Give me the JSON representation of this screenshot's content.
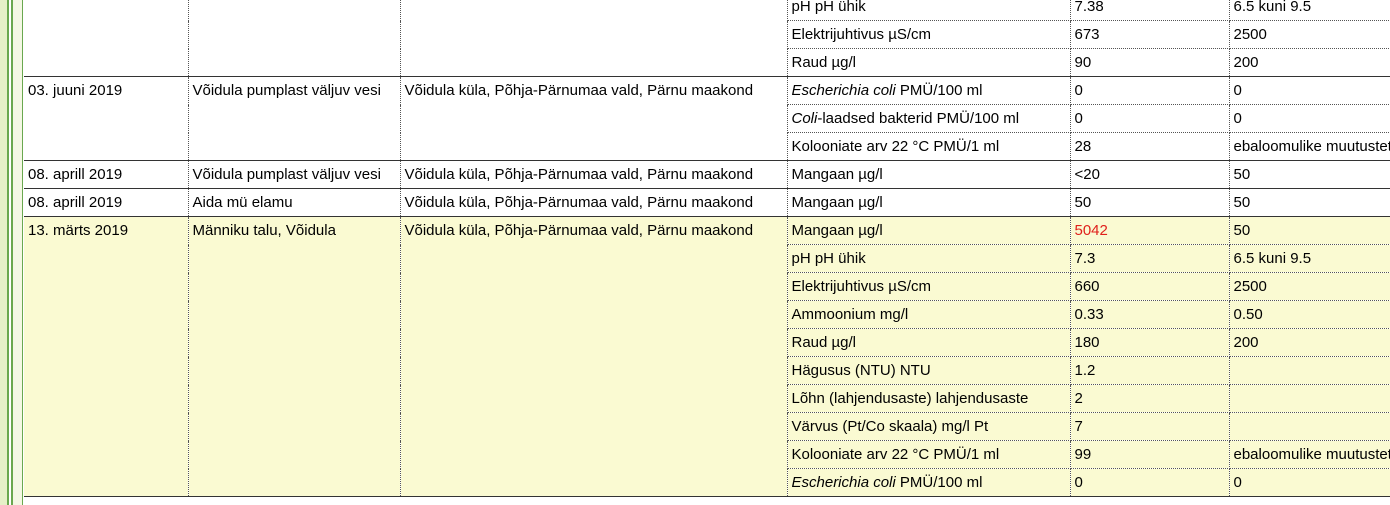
{
  "groups": [
    {
      "date": "",
      "location": "",
      "address": "",
      "highlight": false,
      "rows": [
        {
          "indicator": "pH pH ühik",
          "value": "7.38",
          "norm": "6.5 kuni 9.5"
        },
        {
          "indicator": "Elektrijuhtivus µS/cm",
          "value": "673",
          "norm": "2500"
        },
        {
          "indicator": "Raud µg/l",
          "value": "90",
          "norm": "200"
        }
      ]
    },
    {
      "date": "03. juuni 2019",
      "location": "Võidula pumplast väljuv vesi",
      "address": "Võidula küla, Põhja-Pärnumaa vald, Pärnu maakond",
      "highlight": false,
      "rows": [
        {
          "indicator_italic": "Escherichia coli",
          "indicator_rest": " PMÜ/100 ml",
          "value": "0",
          "norm": "0"
        },
        {
          "indicator_italic": "Coli",
          "indicator_rest": "-laadsed bakterid PMÜ/100 ml",
          "value": "0",
          "norm": "0"
        },
        {
          "indicator": "Kolooniate arv 22 °C PMÜ/1 ml",
          "value": "28",
          "norm": "ebaloomulike muutusteta"
        }
      ]
    },
    {
      "date": "08. aprill 2019",
      "location": "Võidula pumplast väljuv vesi",
      "address": "Võidula küla, Põhja-Pärnumaa vald, Pärnu maakond",
      "highlight": false,
      "rows": [
        {
          "indicator": "Mangaan µg/l",
          "value": "<20",
          "norm": "50"
        }
      ]
    },
    {
      "date": "08. aprill 2019",
      "location": "Aida mü elamu",
      "address": "Võidula küla, Põhja-Pärnumaa vald, Pärnu maakond",
      "highlight": false,
      "rows": [
        {
          "indicator": "Mangaan µg/l",
          "value": "50",
          "norm": "50"
        }
      ]
    },
    {
      "date": "13. märts 2019",
      "location": "Männiku talu, Võidula",
      "address": "Võidula küla, Põhja-Pärnumaa vald, Pärnu maakond",
      "highlight": true,
      "rows": [
        {
          "indicator": "Mangaan µg/l",
          "value": "5042",
          "norm": "50",
          "exceeds": true
        },
        {
          "indicator": "pH pH ühik",
          "value": "7.3",
          "norm": "6.5 kuni 9.5"
        },
        {
          "indicator": "Elektrijuhtivus µS/cm",
          "value": "660",
          "norm": "2500"
        },
        {
          "indicator": "Ammoonium mg/l",
          "value": "0.33",
          "norm": "0.50"
        },
        {
          "indicator": "Raud µg/l",
          "value": "180",
          "norm": "200"
        },
        {
          "indicator": "Hägusus (NTU) NTU",
          "value": "1.2",
          "norm": ""
        },
        {
          "indicator": "Lõhn (lahjendusaste) lahjendusaste",
          "value": "2",
          "norm": ""
        },
        {
          "indicator": "Värvus (Pt/Co skaala) mg/l Pt",
          "value": "7",
          "norm": ""
        },
        {
          "indicator": "Kolooniate arv 22 °C PMÜ/1 ml",
          "value": "99",
          "norm": "ebaloomulike muutusteta"
        },
        {
          "indicator_italic": "Escherichia coli",
          "indicator_rest": " PMÜ/100 ml",
          "value": "0",
          "norm": "0"
        }
      ]
    }
  ],
  "colors": {
    "highlight_bg": "#fafad2",
    "exceeds_text": "#e0201b",
    "rail_green": "#6aa84f"
  }
}
